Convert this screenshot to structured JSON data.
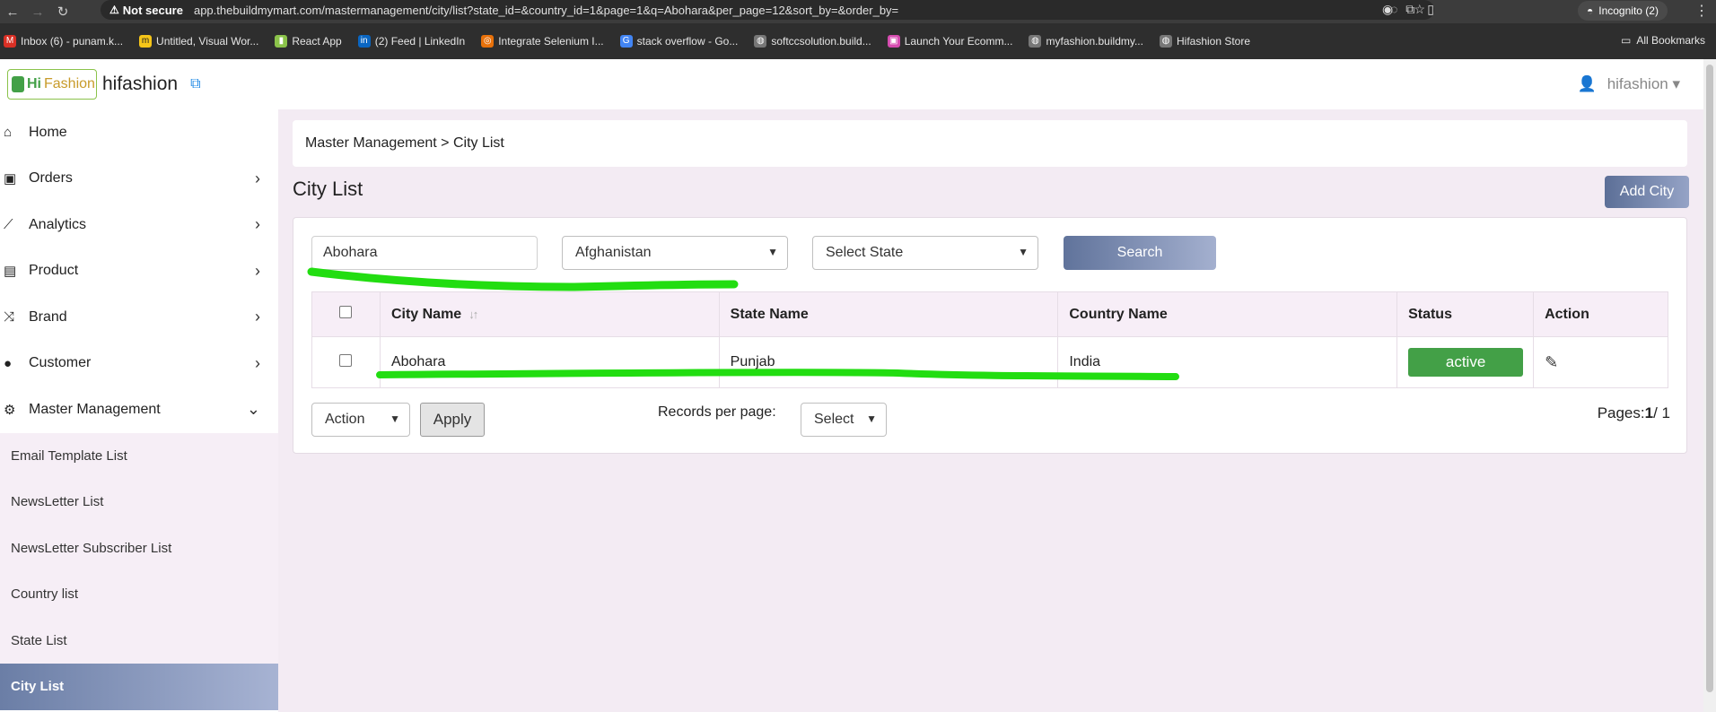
{
  "browser": {
    "security_label": "Not secure",
    "url": "app.thebuildmymart.com/mastermanagement/city/list?state_id=&country_id=1&page=1&q=Abohara&per_page=12&sort_by=&order_by=",
    "incognito_label": "Incognito (2)",
    "bookmarks": [
      {
        "label": "Inbox (6) - punam.k...",
        "color": "#d93025",
        "glyph": "M"
      },
      {
        "label": "Untitled, Visual Wor...",
        "color": "#f5c518",
        "glyph": "m"
      },
      {
        "label": "React App",
        "color": "#8bc34a",
        "glyph": "▮"
      },
      {
        "label": "(2) Feed | LinkedIn",
        "color": "#0a66c2",
        "glyph": "in"
      },
      {
        "label": "Integrate Selenium I...",
        "color": "#e8710a",
        "glyph": "◎"
      },
      {
        "label": "stack overflow - Go...",
        "color": "#4285f4",
        "glyph": "G"
      },
      {
        "label": "softccsolution.build...",
        "color": "#777777",
        "glyph": "◍"
      },
      {
        "label": "Launch Your Ecomm...",
        "color": "#d64bb0",
        "glyph": "▣"
      },
      {
        "label": "myfashion.buildmy...",
        "color": "#777777",
        "glyph": "◍"
      },
      {
        "label": "Hifashion Store",
        "color": "#777777",
        "glyph": "◍"
      }
    ],
    "all_bookmarks_label": "All Bookmarks"
  },
  "header": {
    "logo_hi": "Hi",
    "logo_fashion": "Fashion",
    "brand_name": "hifashion",
    "user_name": "hifashion ▾"
  },
  "sidebar": {
    "items": [
      {
        "label": "Home",
        "icon": "home-icon"
      },
      {
        "label": "Orders",
        "icon": "shopping-bag-icon"
      },
      {
        "label": "Analytics",
        "icon": "chart-icon"
      },
      {
        "label": "Product",
        "icon": "box-icon"
      },
      {
        "label": "Brand",
        "icon": "shuffle-icon"
      },
      {
        "label": "Customer",
        "icon": "user-icon"
      },
      {
        "label": "Master Management",
        "icon": "user-gear-icon"
      }
    ],
    "sub_items": [
      "Email Template List",
      "NewsLetter List",
      "NewsLetter Subscriber List",
      "Country list",
      "State List",
      "City List"
    ]
  },
  "main": {
    "breadcrumb": "Master Management > City List",
    "title": "City List",
    "add_button": "Add City",
    "search_value": "Abohara",
    "country_selected": "Afghanistan",
    "state_selected": "Select State",
    "search_button": "Search",
    "columns": [
      "City Name",
      "State Name",
      "Country Name",
      "Status",
      "Action"
    ],
    "rows": [
      {
        "city": "Abohara",
        "state": "Punjab",
        "country": "India",
        "status": "active"
      }
    ],
    "action_select": "Action",
    "apply_button": "Apply",
    "records_label": "Records per page:",
    "records_select": "Select",
    "pages_label": "Pages:",
    "pages_current": "1",
    "pages_total": "/ 1"
  },
  "colors": {
    "accent_gradient_start": "#5c6f97",
    "status_active": "#43a047",
    "highlight_marker": "#22dd11"
  }
}
